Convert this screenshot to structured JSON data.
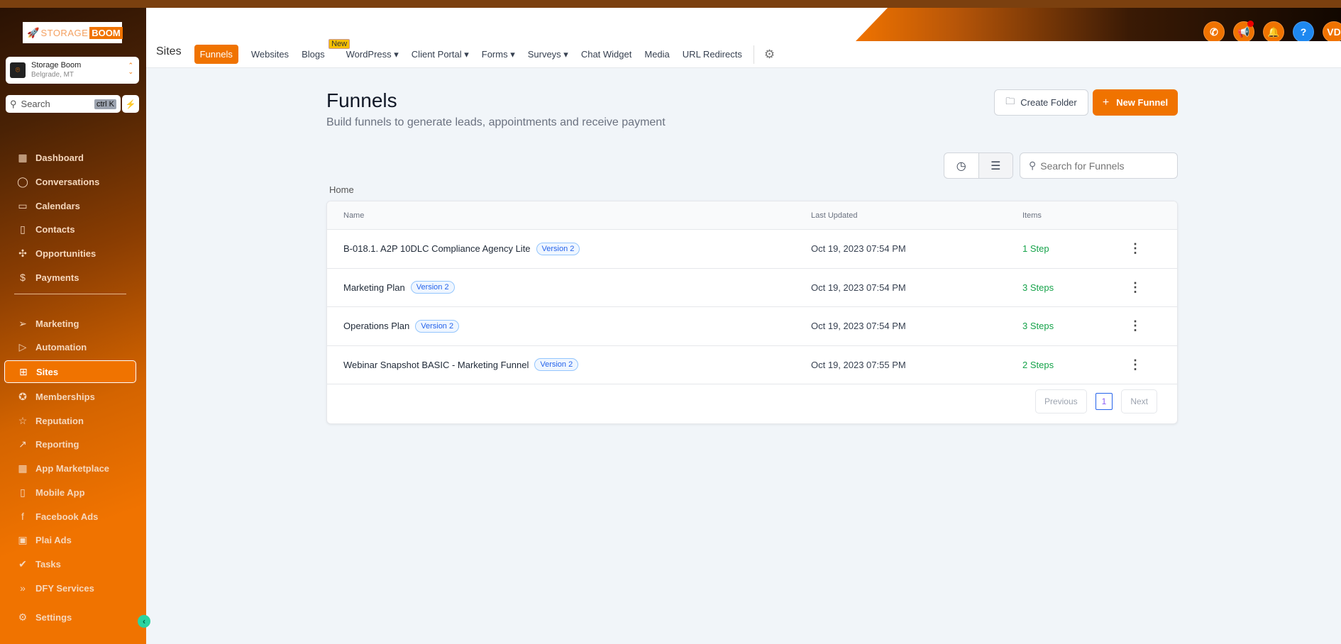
{
  "brand": {
    "logo_text_1": "STORAGE",
    "logo_text_2": "BOOM",
    "accent": "#f07300"
  },
  "location": {
    "name": "Storage Boom",
    "city": "Belgrade, MT"
  },
  "sidebar_search": {
    "placeholder": "Search",
    "shortcut": "ctrl K"
  },
  "sidebar": {
    "items": [
      {
        "label": "Dashboard",
        "icon": "dashboard-icon",
        "glyph": "▦"
      },
      {
        "label": "Conversations",
        "icon": "chat-icon",
        "glyph": "◯"
      },
      {
        "label": "Calendars",
        "icon": "calendar-icon",
        "glyph": "▭"
      },
      {
        "label": "Contacts",
        "icon": "contacts-icon",
        "glyph": "▯"
      },
      {
        "label": "Opportunities",
        "icon": "opportunities-icon",
        "glyph": "✣"
      },
      {
        "label": "Payments",
        "icon": "payments-icon",
        "glyph": "$"
      },
      {
        "label": "Marketing",
        "icon": "send-icon",
        "glyph": "➢"
      },
      {
        "label": "Automation",
        "icon": "automation-icon",
        "glyph": "▷"
      },
      {
        "label": "Sites",
        "icon": "sites-icon",
        "glyph": "⊞",
        "active": true
      },
      {
        "label": "Memberships",
        "icon": "award-icon",
        "glyph": "✪"
      },
      {
        "label": "Reputation",
        "icon": "star-icon",
        "glyph": "☆"
      },
      {
        "label": "Reporting",
        "icon": "trend-icon",
        "glyph": "↗"
      },
      {
        "label": "App Marketplace",
        "icon": "apps-icon",
        "glyph": "▦"
      },
      {
        "label": "Mobile App",
        "icon": "mobile-icon",
        "glyph": "▯"
      },
      {
        "label": "Facebook Ads",
        "icon": "facebook-icon",
        "glyph": "f"
      },
      {
        "label": "Plai Ads",
        "icon": "ad-icon",
        "glyph": "▣"
      },
      {
        "label": "Tasks",
        "icon": "check-icon",
        "glyph": "✔"
      },
      {
        "label": "DFY Services",
        "icon": "double-chevron-icon",
        "glyph": "»"
      }
    ],
    "settings": "Settings"
  },
  "header": {
    "avatar_initials": "VD"
  },
  "subnav": {
    "section": "Sites",
    "tabs": [
      "Funnels",
      "Websites",
      "Blogs",
      "WordPress ▾",
      "Client Portal ▾",
      "Forms ▾",
      "Surveys ▾",
      "Chat Widget",
      "Media",
      "URL Redirects"
    ],
    "new_badge": "New"
  },
  "page": {
    "title": "Funnels",
    "subtitle": "Build funnels to generate leads, appointments and receive payment",
    "create_folder": "Create Folder",
    "new_funnel": "New Funnel",
    "search_placeholder": "Search for Funnels",
    "breadcrumb": "Home"
  },
  "table": {
    "columns": [
      "Name",
      "Last Updated",
      "Items"
    ],
    "rows": [
      {
        "name": "B-018.1. A2P 10DLC Compliance Agency Lite",
        "version": "Version 2",
        "updated": "Oct 19, 2023 07:54 PM",
        "items": "1 Step"
      },
      {
        "name": "Marketing Plan",
        "version": "Version 2",
        "updated": "Oct 19, 2023 07:54 PM",
        "items": "3 Steps"
      },
      {
        "name": "Operations Plan",
        "version": "Version 2",
        "updated": "Oct 19, 2023 07:54 PM",
        "items": "3 Steps"
      },
      {
        "name": "Webinar Snapshot BASIC - Marketing Funnel",
        "version": "Version 2",
        "updated": "Oct 19, 2023 07:55 PM",
        "items": "2 Steps"
      }
    ]
  },
  "pagination": {
    "previous": "Previous",
    "current": "1",
    "next": "Next"
  }
}
